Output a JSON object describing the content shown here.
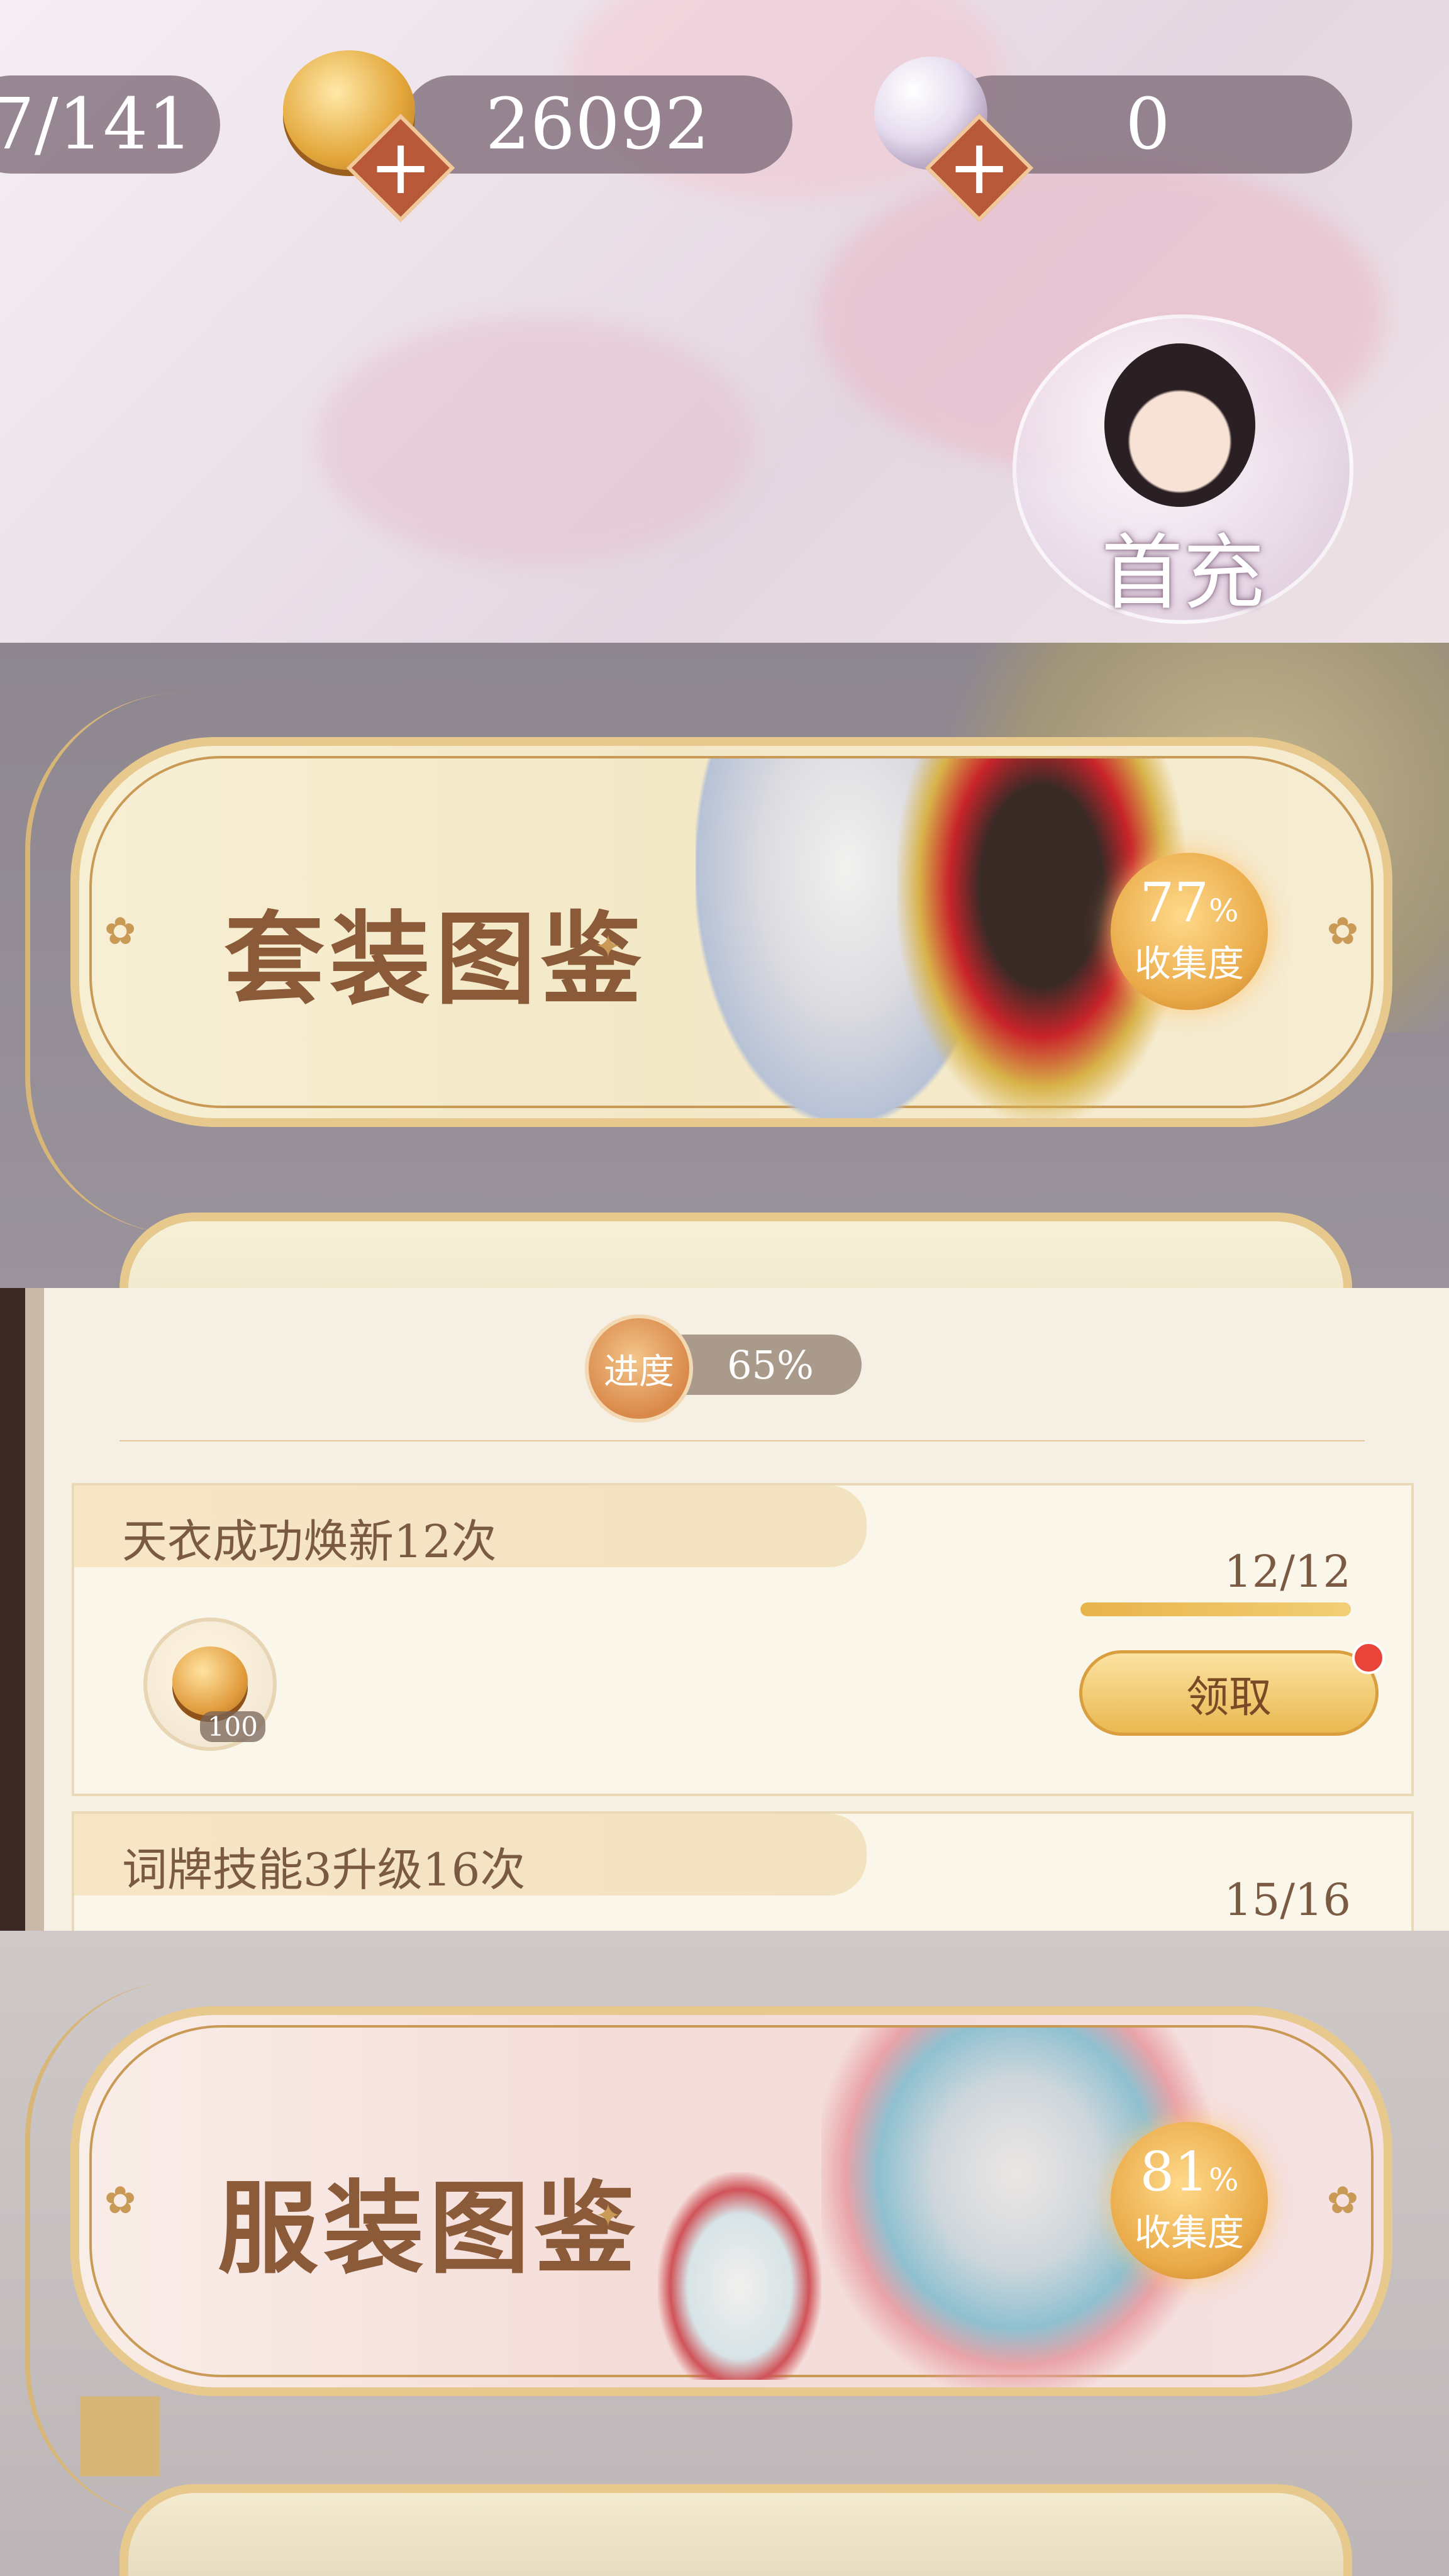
{
  "currency_bar": {
    "stamina_value": "7/141",
    "gold_value": "26092",
    "pearl_value": "0",
    "plus_symbol": "+",
    "first_recharge_label": "首充",
    "gold_icon": "gold-coin-icon",
    "pearl_icon": "pearl-icon"
  },
  "suit_catalog": {
    "title": "套装图鉴",
    "percent": "77",
    "percent_sign": "%",
    "collect_label": "收集度"
  },
  "tasks": {
    "progress_badge": "进度",
    "progress_value": "65%",
    "items": [
      {
        "title": "天衣成功焕新12次",
        "count": "12/12",
        "progress": 1.0,
        "reward_qty": "100",
        "action": "领取"
      },
      {
        "title": "词牌技能3升级16次",
        "count": "15/16",
        "progress": 0.9375
      }
    ]
  },
  "outfit_catalog": {
    "title": "服装图鉴",
    "percent": "81",
    "percent_sign": "%",
    "collect_label": "收集度"
  },
  "colors": {
    "accent_gold": "#e7c98e",
    "title_brown": "#8b5a38",
    "notification_red": "#e8443a"
  }
}
